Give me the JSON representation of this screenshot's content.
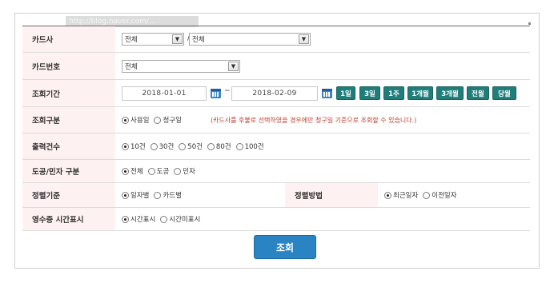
{
  "watermark": "http://blog.naver.com/...",
  "card_company": {
    "label": "카드사",
    "select1": "전체",
    "separator": "/",
    "select2": "전체"
  },
  "card_number": {
    "label": "카드번호",
    "select": "전체"
  },
  "period": {
    "label": "조회기간",
    "start": "2018-01-01",
    "tilde": "~",
    "end": "2018-02-09",
    "buttons": [
      "1일",
      "3일",
      "1주",
      "1개월",
      "3개월",
      "전월",
      "당월"
    ]
  },
  "query_type": {
    "label": "조회구분",
    "options": [
      "사용일",
      "청구일"
    ],
    "selected": 0,
    "note": "(카드사를 후불로 선택하였을 경우에만 청구일 기준으로 조회할 수 있습니다.)"
  },
  "output_count": {
    "label": "출력건수",
    "options": [
      "10건",
      "30건",
      "50건",
      "80건",
      "100건"
    ],
    "selected": 0
  },
  "card_type": {
    "label": "도공/민자 구분",
    "options": [
      "전체",
      "도공",
      "민자"
    ],
    "selected": 0
  },
  "sort_basis": {
    "label": "정렬기준",
    "options": [
      "일자별",
      "카드별"
    ],
    "selected": 0
  },
  "sort_method": {
    "label": "정렬방법",
    "options": [
      "최근일자",
      "이전일자"
    ],
    "selected": 0
  },
  "receipt_time": {
    "label": "영수증 시간표시",
    "options": [
      "시간표시",
      "시간미표시"
    ],
    "selected": 0
  },
  "submit_label": "조회"
}
